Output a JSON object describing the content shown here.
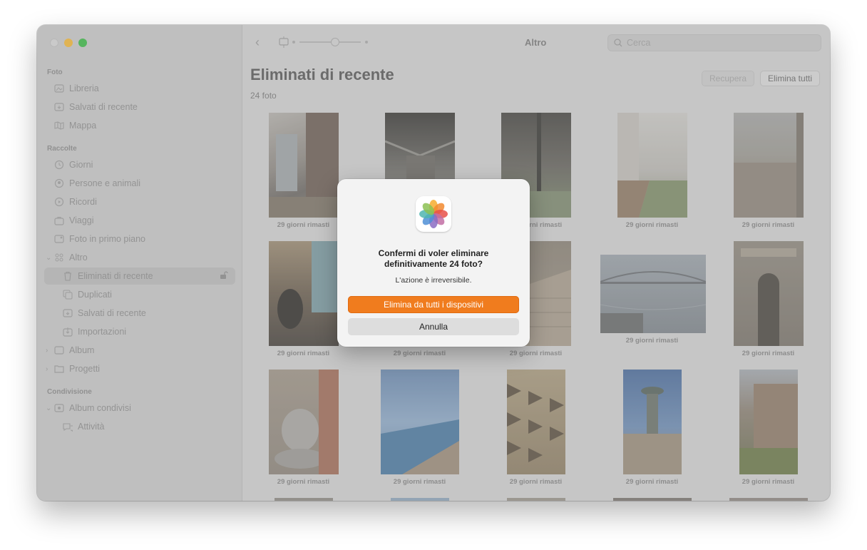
{
  "window": {
    "title": "Altro"
  },
  "sidebar": {
    "sections": [
      {
        "label": "Foto"
      },
      {
        "label": "Raccolte"
      },
      {
        "label": "Condivisione"
      }
    ],
    "items": [
      {
        "label": "Libreria",
        "icon": "library-icon"
      },
      {
        "label": "Salvati di recente",
        "icon": "saved-recent-icon"
      },
      {
        "label": "Mappa",
        "icon": "map-icon"
      },
      {
        "label": "Giorni",
        "icon": "days-icon"
      },
      {
        "label": "Persone e animali",
        "icon": "people-icon"
      },
      {
        "label": "Ricordi",
        "icon": "memories-icon"
      },
      {
        "label": "Viaggi",
        "icon": "trips-icon"
      },
      {
        "label": "Foto in primo piano",
        "icon": "featured-icon"
      },
      {
        "label": "Altro",
        "icon": "other-icon"
      },
      {
        "label": "Eliminati di recente",
        "icon": "trash-icon"
      },
      {
        "label": "Duplicati",
        "icon": "duplicates-icon"
      },
      {
        "label": "Salvati di recente",
        "icon": "saved-recent-icon"
      },
      {
        "label": "Importazioni",
        "icon": "imports-icon"
      },
      {
        "label": "Album",
        "icon": "album-icon"
      },
      {
        "label": "Progetti",
        "icon": "projects-icon"
      },
      {
        "label": "Album condivisi",
        "icon": "shared-album-icon"
      },
      {
        "label": "Attività",
        "icon": "activity-icon"
      }
    ]
  },
  "toolbar": {
    "title": "Altro",
    "search_placeholder": "Cerca"
  },
  "main": {
    "title": "Eliminati di recente",
    "count": "24 foto",
    "recover_label": "Recupera",
    "delete_all_label": "Elimina tutti",
    "caption": "29 giorni rimasti"
  },
  "dialog": {
    "title": "Confermi di voler eliminare definitivamente 24 foto?",
    "message": "L'azione è irreversibile.",
    "primary_label": "Elimina da tutti i dispositivi",
    "cancel_label": "Annulla"
  }
}
